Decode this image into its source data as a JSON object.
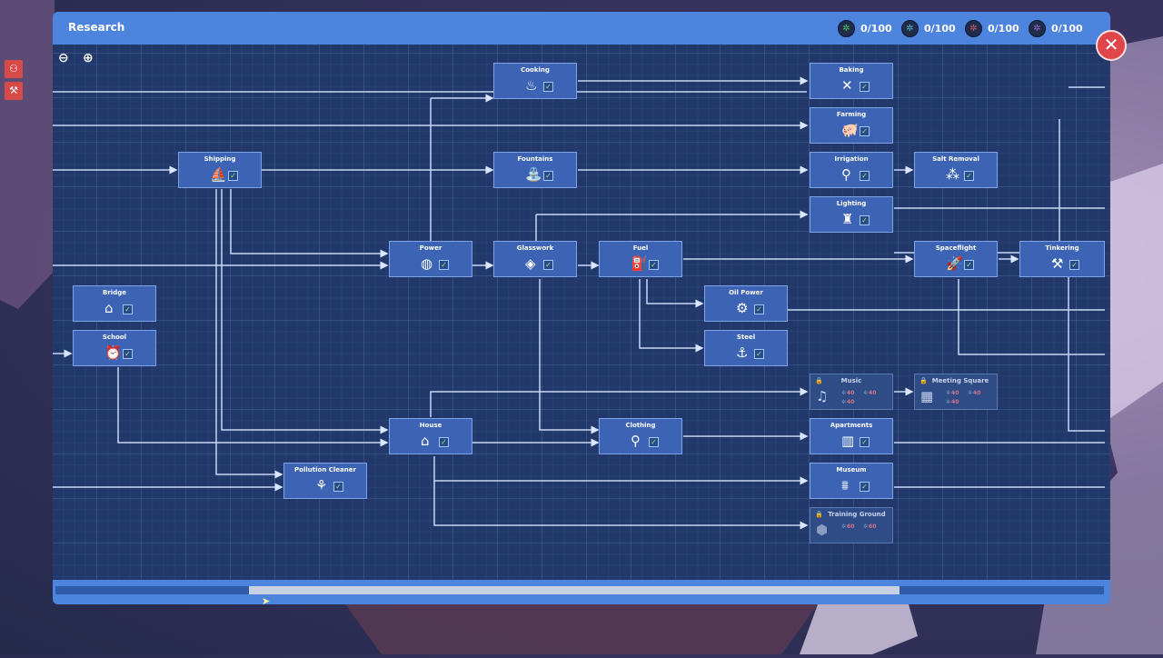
{
  "window": {
    "title": "Research"
  },
  "resources": [
    {
      "icon": "green-research-icon",
      "value": "0/100",
      "color": "#4fc86a"
    },
    {
      "icon": "teal-research-icon",
      "value": "0/100",
      "color": "#4fb8c8"
    },
    {
      "icon": "red-research-icon",
      "value": "0/100",
      "color": "#d45a6a"
    },
    {
      "icon": "purple-research-icon",
      "value": "0/100",
      "color": "#9a6ad4"
    }
  ],
  "checkmark": "✓",
  "lock_symbol": "🔒",
  "close_symbol": "✕",
  "zoom": {
    "out": "⊖",
    "in": "⊕"
  },
  "nodes": {
    "cooking": "Cooking",
    "baking": "Baking",
    "farming": "Farming",
    "shipping": "Shipping",
    "fountains": "Fountains",
    "irrigation": "Irrigation",
    "salt_removal": "Salt Removal",
    "lighting": "Lighting",
    "power": "Power",
    "glasswork": "Glasswork",
    "fuel": "Fuel",
    "spaceflight": "Spaceflight",
    "tinkering": "Tinkering",
    "bridge": "Bridge",
    "oil_power": "Oil Power",
    "school": "School",
    "steel": "Steel",
    "music": "Music",
    "meeting_square": "Meeting Square",
    "house": "House",
    "clothing": "Clothing",
    "apartments": "Apartments",
    "pollution_cleaner": "Pollution Cleaner",
    "museum": "Museum",
    "training_ground": "Training Ground"
  },
  "costs": {
    "music": [
      "40",
      "40",
      "40"
    ],
    "meeting_square": [
      "40",
      "40",
      "40"
    ],
    "training_ground": [
      "60",
      "60"
    ]
  },
  "scroll": {
    "thumb_start": 0.185,
    "thumb_length": 0.62
  }
}
